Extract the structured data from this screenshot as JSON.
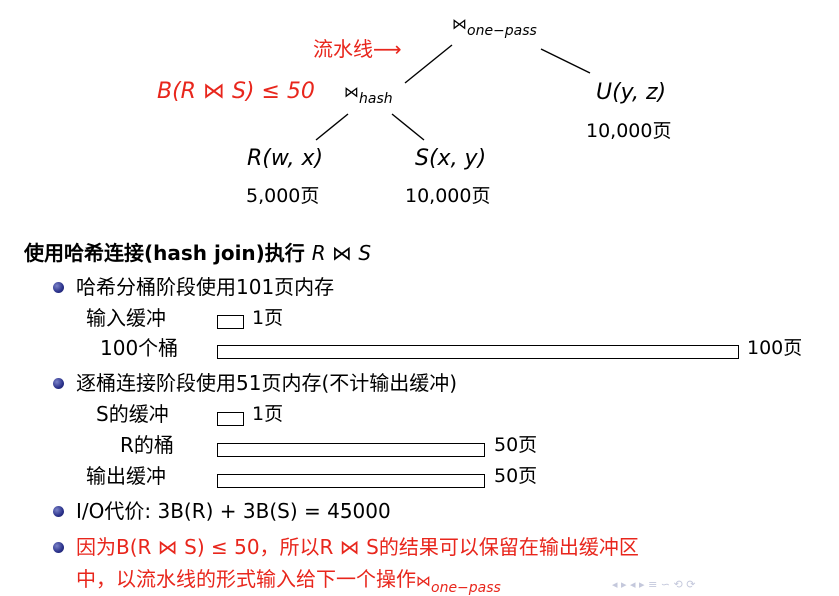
{
  "tree": {
    "root_symbol": "⋈",
    "root_sub": "one−pass",
    "pipeline_label": "流水线",
    "pipeline_arrow": "⟶",
    "condition_text": "B(R ⋈ S) ≤ 50",
    "hash_symbol": "⋈",
    "hash_sub": "hash",
    "u_label": "U(y, z)",
    "u_pages": "10,000页",
    "r_label": "R(w, x)",
    "r_pages": "5,000页",
    "s_label": "S(x, y)",
    "s_pages": "10,000页"
  },
  "section": {
    "heading_text": "使用哈希连接(hash join)执行",
    "heading_formula": "R ⋈ S"
  },
  "phase1": {
    "bullet": "哈希分桶阶段使用101页内存",
    "input_label": "输入缓冲",
    "input_size": "1页",
    "buckets_label": "100个桶",
    "buckets_size": "100页"
  },
  "phase2": {
    "bullet": "逐桶连接阶段使用51页内存(不计输出缓冲)",
    "s_label": "S的缓冲",
    "s_size": "1页",
    "r_label": "R的桶",
    "r_size": "50页",
    "out_label": "输出缓冲",
    "out_size": "50页"
  },
  "cost": {
    "text": "I/O代价: 3B(R) + 3B(S) = 45000"
  },
  "note": {
    "line1": "因为B(R ⋈ S) ≤ 50，所以R ⋈ S的结果可以保留在输出缓冲区",
    "line2_text": "中，以流水线的形式输入给下一个操作",
    "line2_symbol": "⋈",
    "line2_sub": "one−pass"
  },
  "colors": {
    "accent_red": "#e8261c",
    "bullet_blue": "#2a318a",
    "nav_gray": "#c4c8dc"
  },
  "nav_glyphs": "◂ ▸ ◂ ▸ ≡ ∽ ⟲ ⟳"
}
